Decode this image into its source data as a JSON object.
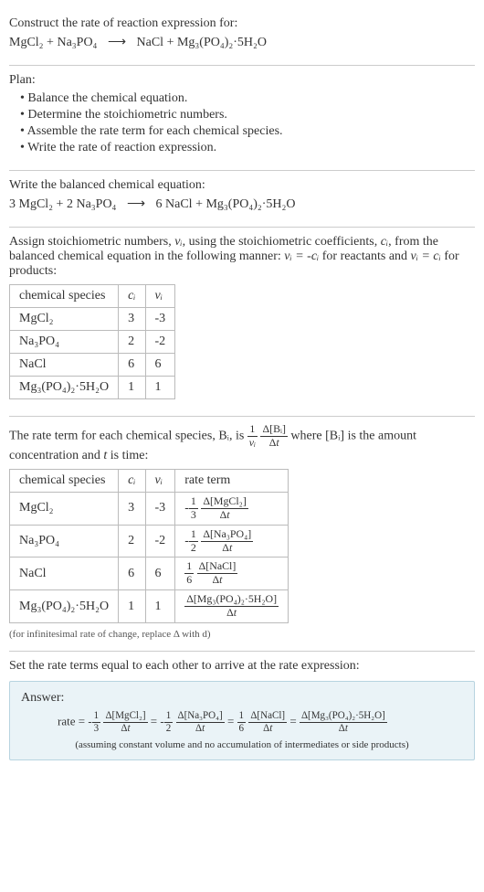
{
  "header": {
    "prompt": "Construct the rate of reaction expression for:",
    "equation_lhs": "MgCl₂ + Na₃PO₄",
    "equation_rhs": "NaCl + Mg₃(PO₄)₂·5H₂O"
  },
  "plan": {
    "title": "Plan:",
    "items": [
      "Balance the chemical equation.",
      "Determine the stoichiometric numbers.",
      "Assemble the rate term for each chemical species.",
      "Write the rate of reaction expression."
    ]
  },
  "balanced": {
    "title": "Write the balanced chemical equation:",
    "equation_lhs": "3 MgCl₂ + 2 Na₃PO₄",
    "equation_rhs": "6 NaCl + Mg₃(PO₄)₂·5H₂O"
  },
  "stoich": {
    "intro_a": "Assign stoichiometric numbers, ",
    "nu": "νᵢ",
    "intro_b": ", using the stoichiometric coefficients, ",
    "ci": "cᵢ",
    "intro_c": ", from the balanced chemical equation in the following manner: ",
    "eq1": "νᵢ = -cᵢ",
    "intro_d": " for reactants and ",
    "eq2": "νᵢ = cᵢ",
    "intro_e": " for products:",
    "headers": {
      "species": "chemical species",
      "c": "cᵢ",
      "nu": "νᵢ"
    },
    "rows": [
      {
        "species": "MgCl₂",
        "c": "3",
        "nu": "-3"
      },
      {
        "species": "Na₃PO₄",
        "c": "2",
        "nu": "-2"
      },
      {
        "species": "NaCl",
        "c": "6",
        "nu": "6"
      },
      {
        "species": "Mg₃(PO₄)₂·5H₂O",
        "c": "1",
        "nu": "1"
      }
    ]
  },
  "rateterm": {
    "intro_a": "The rate term for each chemical species, Bᵢ, is ",
    "intro_b": " where [Bᵢ] is the amount concentration and ",
    "tvar": "t",
    "intro_c": " is time:",
    "headers": {
      "species": "chemical species",
      "c": "cᵢ",
      "nu": "νᵢ",
      "rate": "rate term"
    },
    "rows": [
      {
        "species": "MgCl₂",
        "c": "3",
        "nu": "-3",
        "coef_num": "1",
        "coef_den": "3",
        "sign": "-",
        "conc": "Δ[MgCl₂]"
      },
      {
        "species": "Na₃PO₄",
        "c": "2",
        "nu": "-2",
        "coef_num": "1",
        "coef_den": "2",
        "sign": "-",
        "conc": "Δ[Na₃PO₄]"
      },
      {
        "species": "NaCl",
        "c": "6",
        "nu": "6",
        "coef_num": "1",
        "coef_den": "6",
        "sign": "",
        "conc": "Δ[NaCl]"
      },
      {
        "species": "Mg₃(PO₄)₂·5H₂O",
        "c": "1",
        "nu": "1",
        "coef_num": "",
        "coef_den": "",
        "sign": "",
        "conc": "Δ[Mg₃(PO₄)₂·5H₂O]"
      }
    ],
    "note": "(for infinitesimal rate of change, replace Δ with d)"
  },
  "final": {
    "title": "Set the rate terms equal to each other to arrive at the rate expression:",
    "answer_label": "Answer:",
    "rate_word": "rate = ",
    "note": "(assuming constant volume and no accumulation of intermediates or side products)"
  },
  "chart_data": {
    "type": "table",
    "title": "Stoichiometric numbers and rate terms",
    "tables": [
      {
        "columns": [
          "chemical species",
          "c_i",
          "ν_i"
        ],
        "rows": [
          [
            "MgCl2",
            3,
            -3
          ],
          [
            "Na3PO4",
            2,
            -2
          ],
          [
            "NaCl",
            6,
            6
          ],
          [
            "Mg3(PO4)2·5H2O",
            1,
            1
          ]
        ]
      },
      {
        "columns": [
          "chemical species",
          "c_i",
          "ν_i",
          "rate term"
        ],
        "rows": [
          [
            "MgCl2",
            3,
            -3,
            "-(1/3) Δ[MgCl2]/Δt"
          ],
          [
            "Na3PO4",
            2,
            -2,
            "-(1/2) Δ[Na3PO4]/Δt"
          ],
          [
            "NaCl",
            6,
            6,
            "(1/6) Δ[NaCl]/Δt"
          ],
          [
            "Mg3(PO4)2·5H2O",
            1,
            1,
            "Δ[Mg3(PO4)2·5H2O]/Δt"
          ]
        ]
      }
    ],
    "rate_expression": "rate = -(1/3) Δ[MgCl2]/Δt = -(1/2) Δ[Na3PO4]/Δt = (1/6) Δ[NaCl]/Δt = Δ[Mg3(PO4)2·5H2O]/Δt"
  }
}
